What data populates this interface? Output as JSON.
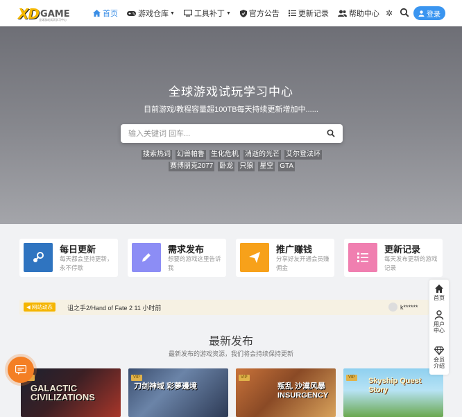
{
  "header": {
    "logo_text_1": "XD",
    "logo_text_2": "GAME",
    "logo_tagline": "全球游戏试玩学习中心",
    "nav": [
      {
        "label": "首页",
        "icon": "home-icon",
        "active": true
      },
      {
        "label": "游戏仓库",
        "icon": "gamepad-icon",
        "dropdown": true
      },
      {
        "label": "工具补丁",
        "icon": "monitor-icon",
        "dropdown": true
      },
      {
        "label": "官方公告",
        "icon": "shield-icon"
      },
      {
        "label": "更新记录",
        "icon": "list-icon"
      },
      {
        "label": "帮助中心",
        "icon": "users-icon"
      }
    ],
    "login_label": "登录"
  },
  "hero": {
    "title": "全球游戏试玩学习中心",
    "subtitle": "目前游戏/教程容量超100TB每天持续更新增加中......",
    "search_placeholder": "输入关键词 回车...",
    "hot_label": "搜索热词",
    "hot_words": [
      "幻兽帕鲁",
      "生化危机",
      "消逝的光芒",
      "艾尔登法环",
      "赛博朋克2077",
      "卧龙",
      "只狼",
      "星空",
      "GTA"
    ]
  },
  "cards": [
    {
      "title": "每日更新",
      "desc": "每天都会坚持更新，永不停歇",
      "color": "#2f74c0",
      "icon": "steam-icon"
    },
    {
      "title": "需求发布",
      "desc": "想要的游戏这里告诉我",
      "color": "#8c8df5",
      "icon": "pencil-icon"
    },
    {
      "title": "推广赚钱",
      "desc": "分享好友开通会员赚佣金",
      "color": "#f7a11a",
      "icon": "paper-plane-icon"
    },
    {
      "title": "更新记录",
      "desc": "每天发布更新的游戏记录",
      "color": "#f07fb0",
      "icon": "list-check-icon"
    }
  ],
  "news": {
    "badge": "网站动态",
    "text": "诅之手2/Hand of Fate 2  11 小时前",
    "user": "k******"
  },
  "latest": {
    "title": "最新发布",
    "subtitle": "最新发布的游戏资源，我们将会持续保持更新",
    "items": [
      {
        "title": "GALACTIC CIVILIZATIONS",
        "vip": "VIP"
      },
      {
        "title": "刀剑神域 彩夢邊境",
        "vip": "VIP"
      },
      {
        "title": "叛乱 沙漠风暴 INSURGENCY",
        "vip": "VIP"
      },
      {
        "title": "Skyship Quest Story",
        "vip": "VIP"
      }
    ]
  },
  "side": {
    "home_label": "首页",
    "user_label": "用户中心",
    "vip_label": "会员介绍"
  },
  "colors": {
    "accent": "#3a8ee6",
    "login_bg": "#3a95f0",
    "badge": "#f5b500",
    "chat": "#f47f24"
  }
}
